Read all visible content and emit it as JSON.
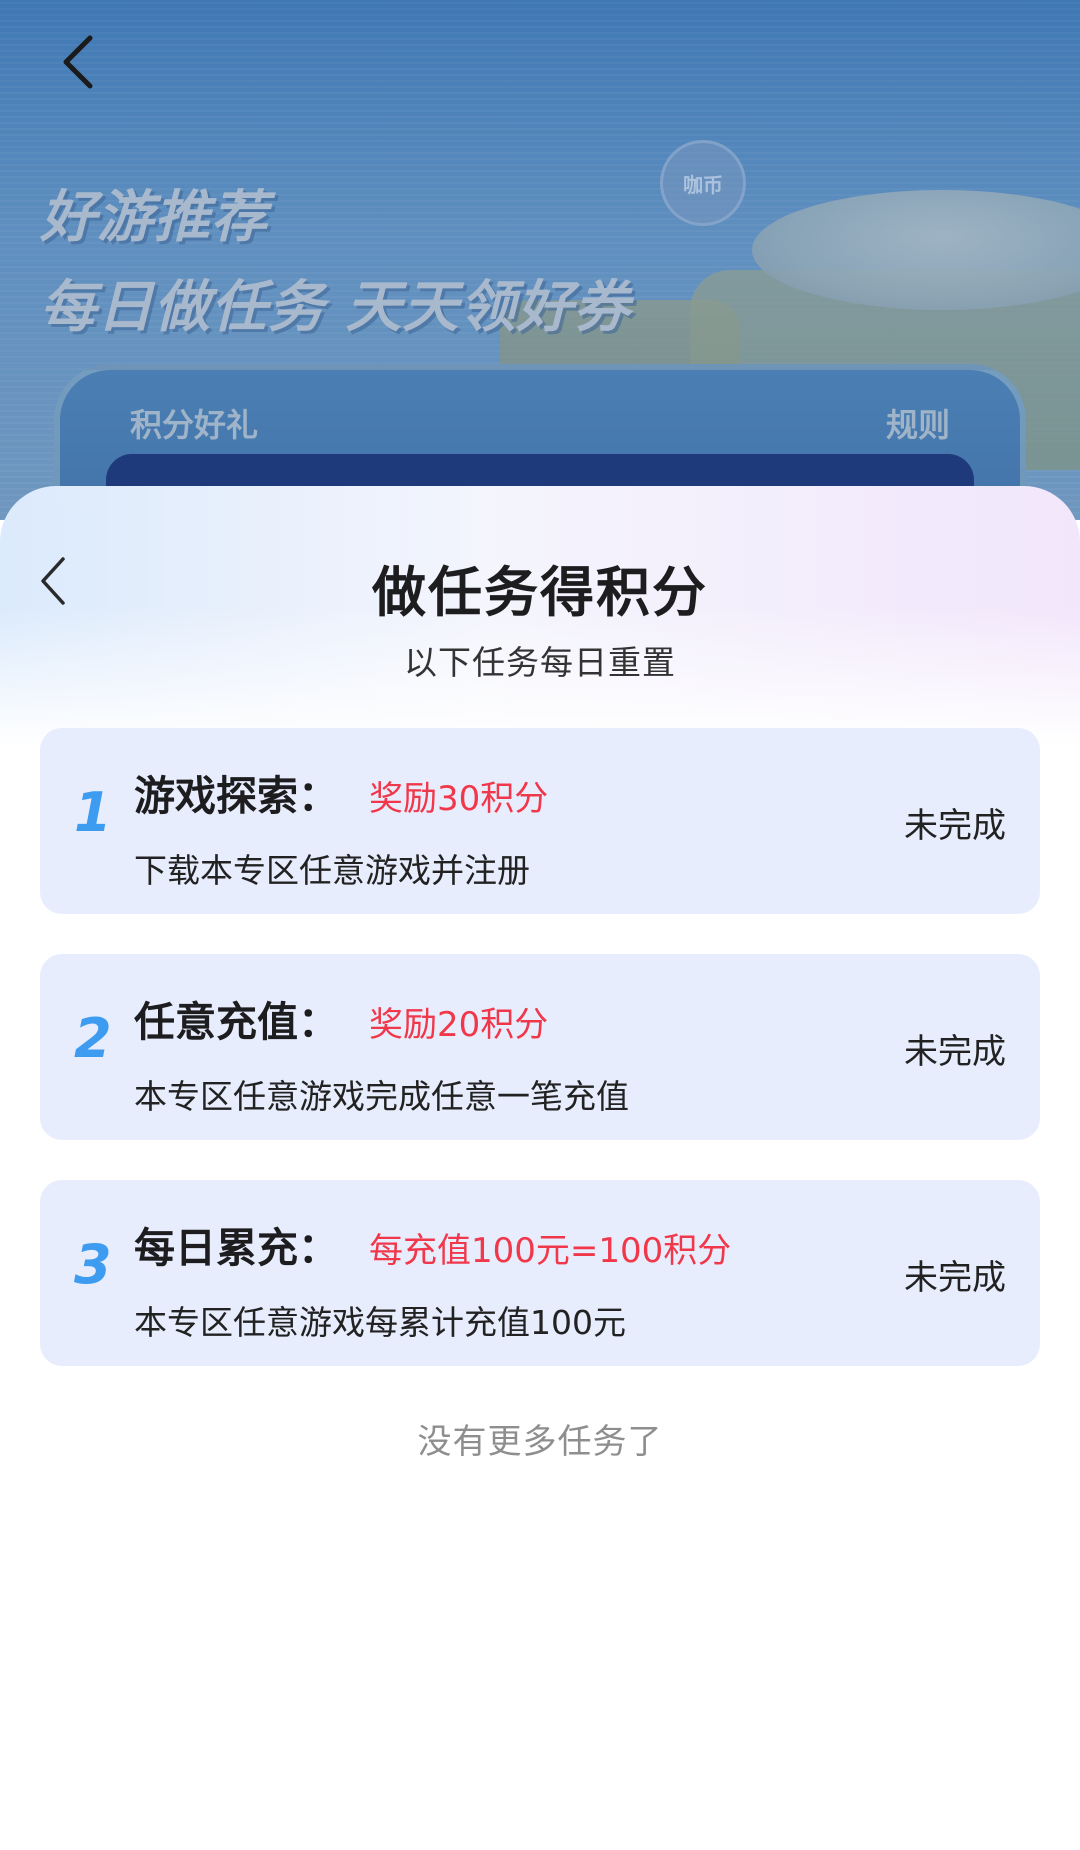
{
  "background": {
    "headline_1": "好游推荐",
    "headline_2": "每日做任务  天天领好券",
    "coin_text": "咖币",
    "card_label_left": "积分好礼",
    "card_label_right": "规则"
  },
  "sheet": {
    "title": "做任务得积分",
    "subtitle": "以下任务每日重置",
    "tasks": [
      {
        "number": "1",
        "name": "游戏探索：",
        "reward": "奖励30积分",
        "description": "下载本专区任意游戏并注册",
        "status": "未完成"
      },
      {
        "number": "2",
        "name": "任意充值：",
        "reward": "奖励20积分",
        "description": "本专区任意游戏完成任意一笔充值",
        "status": "未完成"
      },
      {
        "number": "3",
        "name": "每日累充：",
        "reward": "每充值100元=100积分",
        "description": "本专区任意游戏每累计充值100元",
        "status": "未完成"
      }
    ],
    "footer_note": "没有更多任务了"
  },
  "colors": {
    "task_number": "#3d9bf0",
    "reward_text": "#f0384a",
    "card_background": "#e8edfd"
  },
  "icons": {
    "page_back": "chevron-left-icon",
    "sheet_back": "chevron-left-icon"
  }
}
